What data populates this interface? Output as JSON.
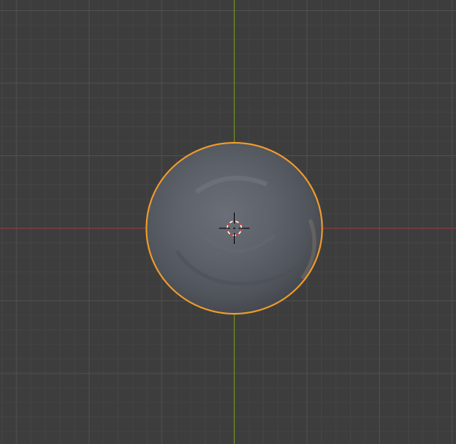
{
  "viewport": {
    "view": "top-orthographic",
    "colors": {
      "background": "#3d3d3d",
      "grid_minor": "#444444",
      "grid_major": "#4f4f4f",
      "x_axis": "#8a3a3f",
      "y_axis": "#6b8e23",
      "selection_outline": "#f29c2b",
      "object_fill": "#5c6068"
    },
    "object": {
      "name_icon": "sculpted-sphere",
      "selected": true
    },
    "cursor_icon": "3d-cursor-icon"
  }
}
